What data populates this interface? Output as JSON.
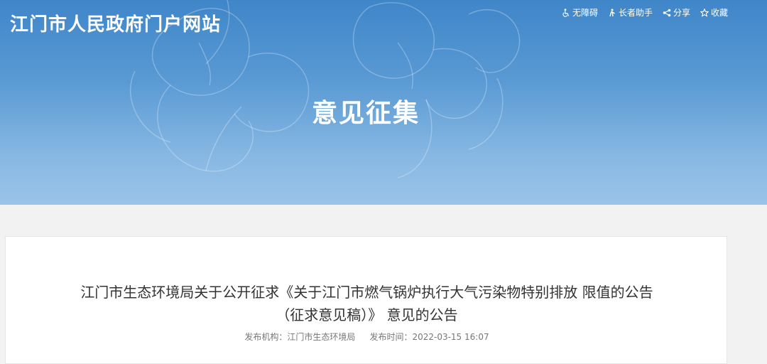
{
  "header": {
    "site_title": "江门市人民政府门户网站",
    "toolbar": [
      {
        "label": "无障碍",
        "icon": "accessibility-icon"
      },
      {
        "label": "长者助手",
        "icon": "elder-assist-icon"
      },
      {
        "label": "分享",
        "icon": "share-icon"
      },
      {
        "label": "收藏",
        "icon": "star-icon"
      }
    ]
  },
  "banner": {
    "section_title": "意见征集"
  },
  "article": {
    "title_line1": "江门市生态环境局关于公开征求《关于江门市燃气锅炉执行大气污染物特别排放 限值的公告",
    "title_line2": "（征求意见稿）》 意见的公告",
    "publisher_label": "发布机构：",
    "publisher": "江门市生态环境局",
    "time_label": "发布时间：",
    "time": "2022-03-15 16:07"
  },
  "colors": {
    "banner_top": "#3f86c9",
    "banner_bottom": "#9ac4e9",
    "page_bg": "#f2f2f2"
  }
}
